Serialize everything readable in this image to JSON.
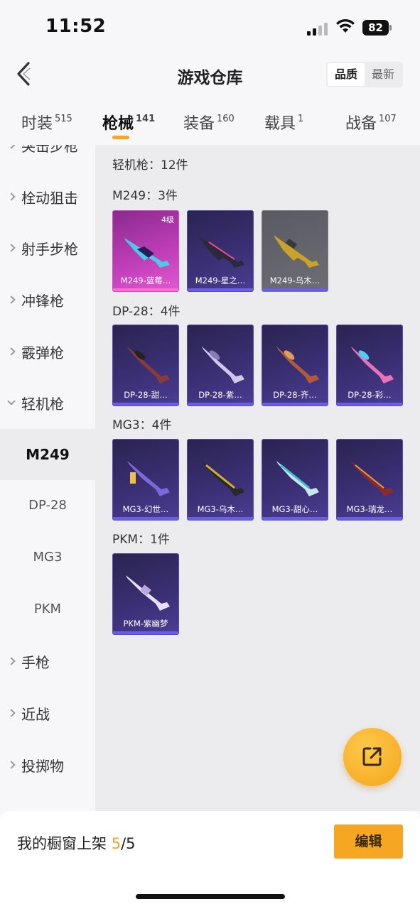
{
  "status": {
    "time": "11:52",
    "battery": "82"
  },
  "header": {
    "title": "游戏仓库",
    "sort_quality": "品质",
    "sort_newest": "最新"
  },
  "tabs": [
    {
      "label": "时装",
      "count": "515"
    },
    {
      "label": "枪械",
      "count": "141"
    },
    {
      "label": "装备",
      "count": "160"
    },
    {
      "label": "载具",
      "count": "1"
    },
    {
      "label": "战备",
      "count": "107"
    }
  ],
  "sidebar": {
    "cut_item": "突击步枪",
    "items": [
      "栓动狙击",
      "射手步枪",
      "冲锋枪",
      "霰弹枪",
      "轻机枪"
    ],
    "sub_items": [
      "M249",
      "DP-28",
      "MG3",
      "PKM"
    ],
    "bottom_items": [
      "手枪",
      "近战",
      "投掷物"
    ]
  },
  "content": {
    "group_count": "轻机枪：12件",
    "groups": [
      {
        "title": "M249：3件",
        "cards": [
          {
            "label": "M249-蓝莓…",
            "level": "4级"
          },
          {
            "label": "M249-星之…"
          },
          {
            "label": "M249-乌木…"
          }
        ]
      },
      {
        "title": "DP-28：4件",
        "cards": [
          {
            "label": "DP-28-甜…"
          },
          {
            "label": "DP-28-紫…"
          },
          {
            "label": "DP-28-齐…"
          },
          {
            "label": "DP-28-彩…"
          }
        ]
      },
      {
        "title": "MG3：4件",
        "cards": [
          {
            "label": "MG3-幻世…"
          },
          {
            "label": "MG3-乌木…"
          },
          {
            "label": "MG3-甜心…"
          },
          {
            "label": "MG3-瑞龙…"
          }
        ]
      },
      {
        "title": "PKM：1件",
        "cards": [
          {
            "label": "PKM-紫幽梦"
          }
        ]
      }
    ]
  },
  "bottom": {
    "showcase_label": "我的橱窗上架",
    "showcase_current": "5",
    "showcase_total": "/5",
    "edit_label": "编辑"
  },
  "colors": {
    "accent": "#f5a623",
    "card_purple": "#3a2f74",
    "card_pink": "#c23fba",
    "card_grey": "#6d6d76"
  }
}
